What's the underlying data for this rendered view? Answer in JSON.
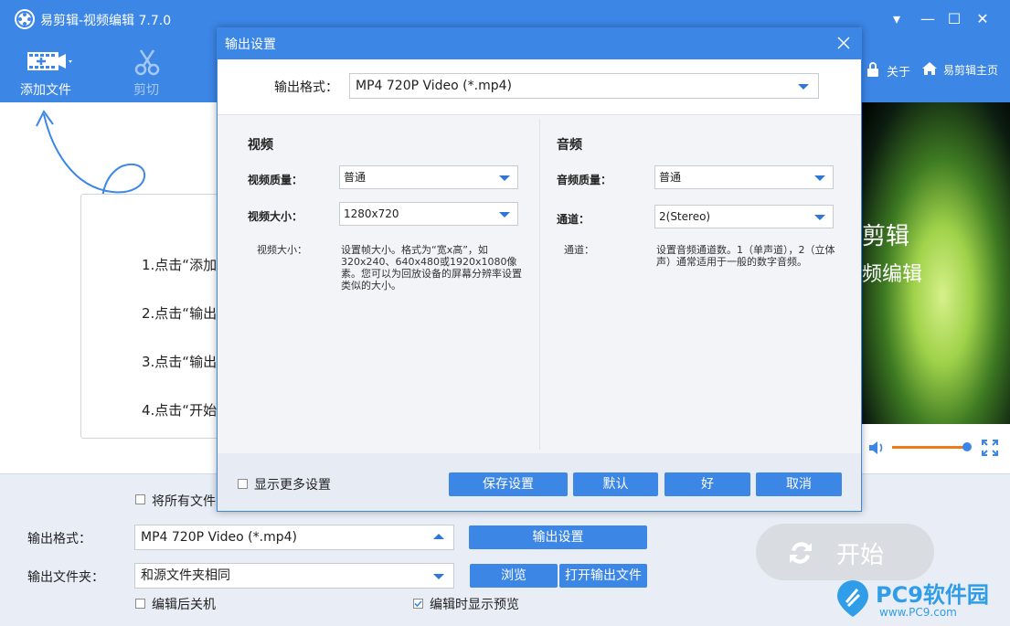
{
  "window": {
    "title": "易剪辑-视频编辑 7.7.0",
    "controls": [
      "▾",
      "—",
      "☐",
      "✕"
    ]
  },
  "toolbar": {
    "add_file": "添加文件",
    "cut": "剪切",
    "about": "关于",
    "home": "易剪辑主页"
  },
  "steps": [
    "1.点击“添加",
    "2.点击“输出",
    "3.点击“输出",
    "4.点击“开始"
  ],
  "preview": {
    "title_line1": "剪辑",
    "title_line2": "频编辑"
  },
  "bottom": {
    "merge_all_label": "将所有文件",
    "output_format_label": "输出格式：",
    "output_format_value": "MP4 720P Video (*.mp4)",
    "output_settings_button": "输出设置",
    "output_folder_label": "输出文件夹：",
    "output_folder_value": "和源文件夹相同",
    "browse_button": "浏览",
    "open_output_button": "打开输出文件",
    "shutdown_label": "编辑后关机",
    "show_preview_label": "编辑时显示预览",
    "show_preview_checked": true,
    "start_button": "开始"
  },
  "watermark": {
    "brand": "PC9软件园",
    "url": "www.PC9.com"
  },
  "dialog": {
    "title": "输出设置",
    "format_label": "输出格式：",
    "format_value": "MP4 720P Video (*.mp4)",
    "video": {
      "heading": "视频",
      "quality_label": "视频质量：",
      "quality_value": "普通",
      "size_label": "视频大小：",
      "size_value": "1280x720",
      "help_label": "视频大小：",
      "help_text": "设置帧大小。格式为“宽x高”，如320x240、640x480或1920x1080像素。您可以为回放设备的屏幕分辨率设置类似的大小。"
    },
    "audio": {
      "heading": "音频",
      "quality_label": "音频质量：",
      "quality_value": "普通",
      "channel_label": "通道：",
      "channel_value": "2(Stereo)",
      "help_label": "通道：",
      "help_text": "设置音频通道数。1（单声道），2（立体声）通常适用于一般的数字音频。"
    },
    "show_more_label": "显示更多设置",
    "save_button": "保存设置",
    "default_button": "默认",
    "ok_button": "好",
    "cancel_button": "取消"
  },
  "colors": {
    "accent": "#3c86e6",
    "bottom_panel": "#e9eef6"
  }
}
